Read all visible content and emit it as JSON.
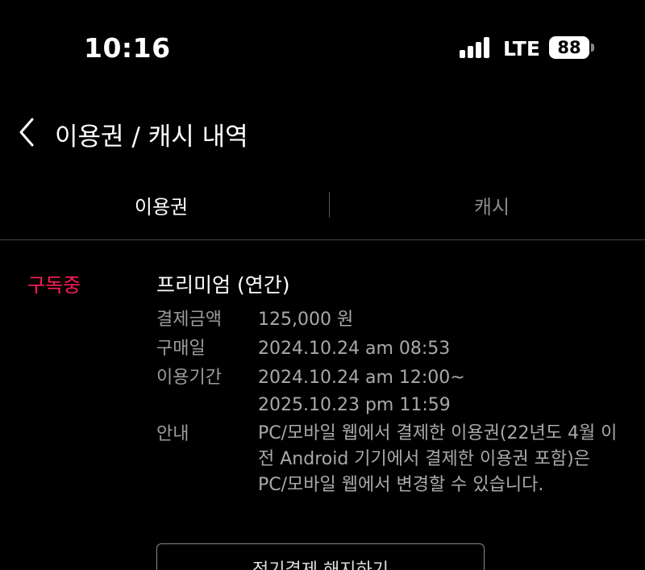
{
  "status_bar": {
    "time": "10:16",
    "network": "LTE",
    "battery": "88"
  },
  "nav": {
    "title": "이용권 / 캐시 내역"
  },
  "tabs": [
    {
      "label": "이용권",
      "active": true
    },
    {
      "label": "캐시",
      "active": false
    }
  ],
  "subscription": {
    "status": "구독중",
    "status_color": "#ff1e56",
    "plan": "프리미엄 (연간)",
    "rows": [
      {
        "label": "결제금액",
        "value": "125,000 원"
      },
      {
        "label": "구매일",
        "value": "2024.10.24 am 08:53"
      },
      {
        "label": "이용기간",
        "value": "2024.10.24 am 12:00~",
        "value2": "2025.10.23 pm 11:59"
      },
      {
        "label": "안내",
        "value": "PC/모바일 웹에서 결제한 이용권(22년도 4월 이전 Android 기기에서 결제한 이용권 포함)은 PC/모바일 웹에서 변경할 수 있습니다."
      }
    ],
    "cancel_label": "정기결제 해지하기"
  }
}
